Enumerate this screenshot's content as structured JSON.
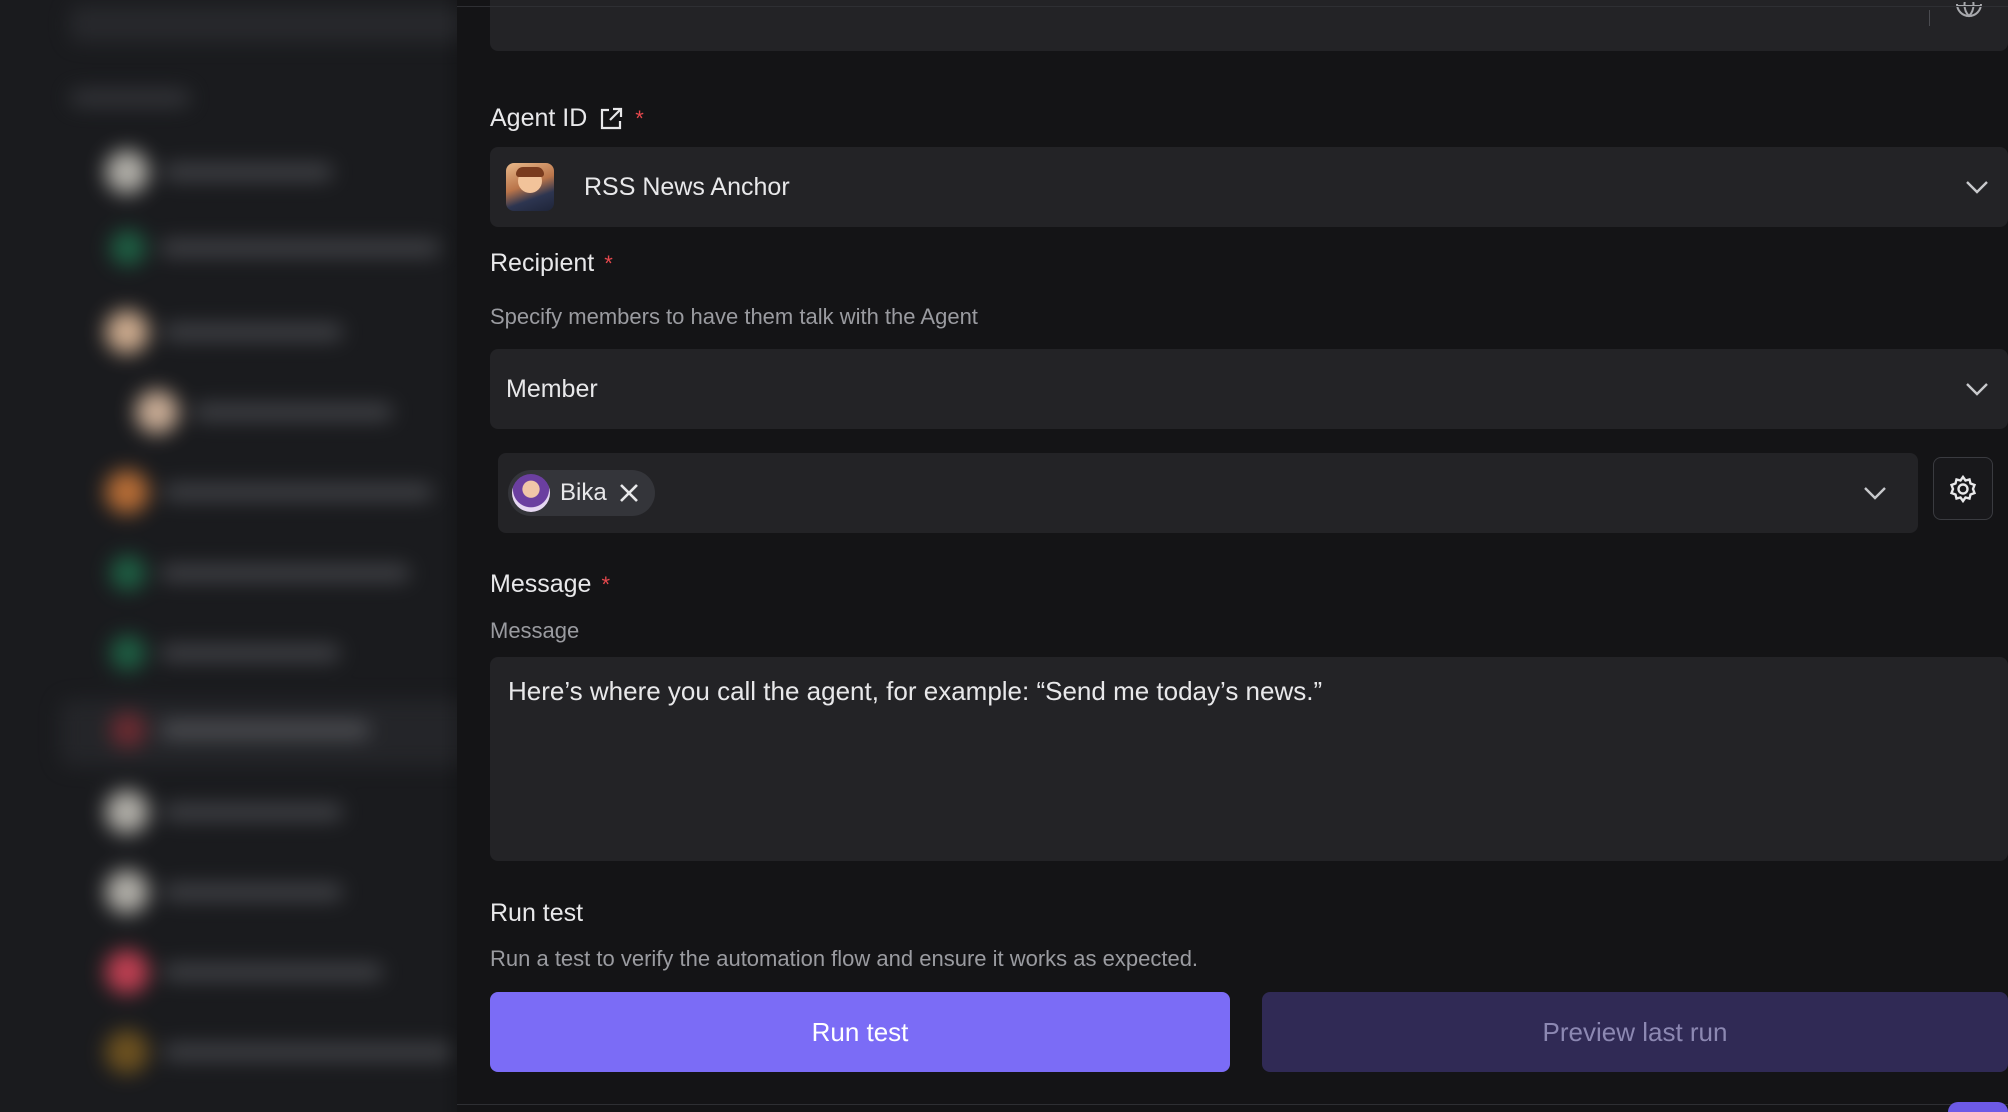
{
  "agent_field": {
    "label": "Agent ID",
    "required_mark": "*",
    "selected_agent": "RSS News Anchor"
  },
  "recipient": {
    "label": "Recipient",
    "required_mark": "*",
    "hint": "Specify members to have them talk with the Agent",
    "type_value": "Member",
    "selected_members": [
      "Bika"
    ]
  },
  "message": {
    "label": "Message",
    "required_mark": "*",
    "sub_label": "Message",
    "value": "Here’s where you call the agent, for example: “Send me today’s news.”"
  },
  "run_test": {
    "title": "Run test",
    "description": "Run a test to verify the automation flow and ensure it works as expected.",
    "run_button": "Run test",
    "preview_button": "Preview last run"
  },
  "colors": {
    "accent": "#7b6cf6",
    "preview_bg": "#302a55",
    "required": "#e5484d"
  }
}
